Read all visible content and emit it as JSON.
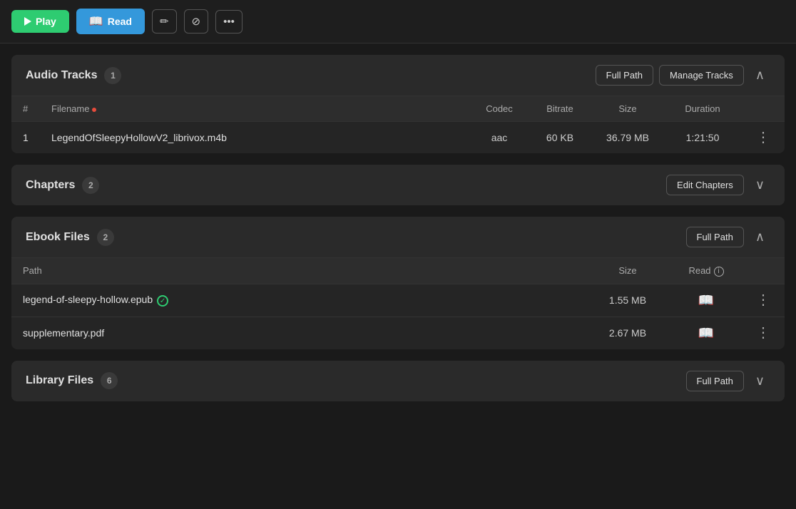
{
  "toolbar": {
    "play_label": "Play",
    "read_label": "Read"
  },
  "audio_tracks": {
    "title": "Audio Tracks",
    "badge": "1",
    "full_path_btn": "Full Path",
    "manage_tracks_btn": "Manage Tracks",
    "columns": [
      "#",
      "Filename",
      "Codec",
      "Bitrate",
      "Size",
      "Duration"
    ],
    "tracks": [
      {
        "num": "1",
        "filename": "LegendOfSleepyHollowV2_librivox.m4b",
        "codec": "aac",
        "bitrate": "60 KB",
        "size": "36.79 MB",
        "duration": "1:21:50"
      }
    ]
  },
  "chapters": {
    "title": "Chapters",
    "badge": "2",
    "edit_chapters_btn": "Edit Chapters"
  },
  "ebook_files": {
    "title": "Ebook Files",
    "badge": "2",
    "full_path_btn": "Full Path",
    "columns": [
      "Path",
      "Size",
      "Read"
    ],
    "files": [
      {
        "path": "legend-of-sleepy-hollow.epub",
        "has_check": true,
        "size": "1.55 MB"
      },
      {
        "path": "supplementary.pdf",
        "has_check": false,
        "size": "2.67 MB"
      }
    ]
  },
  "library_files": {
    "title": "Library Files",
    "badge": "6",
    "full_path_btn": "Full Path"
  },
  "icons": {
    "play": "▶",
    "read_book": "📖",
    "pencil": "✏",
    "bookmark_check": "⊘",
    "dots_horizontal": "···",
    "chevron_up": "∧",
    "chevron_down": "∨",
    "dots_vertical": "⋮",
    "info": "i",
    "check": "✓",
    "book": "📖"
  }
}
